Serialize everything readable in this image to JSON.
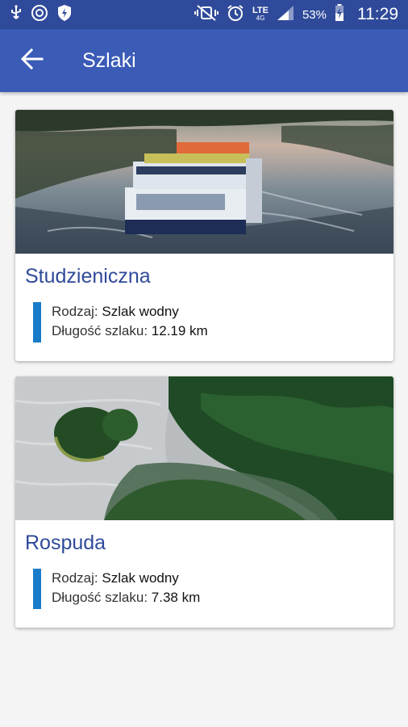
{
  "status_bar": {
    "time": "11:29",
    "battery_percent": "53%",
    "network": "LTE",
    "network_sub": "4G",
    "icons": [
      "usb-icon",
      "sync-icon",
      "shield-icon",
      "vibrate-mute-icon",
      "alarm-icon",
      "signal-icon",
      "battery-icon"
    ]
  },
  "app_bar": {
    "title": "Szlaki",
    "back_icon": "arrow-back-icon",
    "color": "#3a5bb6"
  },
  "trails": [
    {
      "name": "Studzieniczna",
      "type_label": "Rodzaj:",
      "type_value": "Szlak wodny",
      "length_label": "Długość szlaku:",
      "length_value": "12.19 km",
      "image": "boat-on-lake-photo"
    },
    {
      "name": "Rospuda",
      "type_label": "Rodzaj:",
      "type_value": "Szlak wodny",
      "length_label": "Długość szlaku:",
      "length_value": "7.38 km",
      "image": "aerial-forest-river-photo"
    }
  ],
  "colors": {
    "status_bar": "#2f4a9a",
    "title_text": "#2f4a9a",
    "accent_bar": "#1a7cc9"
  }
}
